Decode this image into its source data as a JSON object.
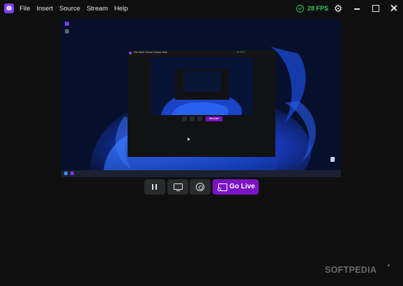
{
  "menu": [
    "File",
    "Insert",
    "Source",
    "Stream",
    "Help"
  ],
  "status": {
    "fps_label": "28 FPS",
    "fps_color": "#39c262"
  },
  "icons": {
    "app": "app-logo-icon",
    "fps": "check-circle-icon",
    "settings": "gear-icon",
    "minimize": "minimize-icon",
    "maximize": "maximize-icon",
    "close": "close-icon",
    "pause": "pause-icon",
    "display": "monitor-icon",
    "capture": "aperture-icon",
    "golive": "cast-icon"
  },
  "controls": {
    "golive_label": "Go Live"
  },
  "nested": {
    "menu": "File  Insert  Source  Stream  Help",
    "fps": "28 FPS",
    "golive": "Go Live"
  },
  "colors": {
    "accent": "#7a14c4",
    "background": "#0f0f10",
    "button": "#2a2b2e"
  },
  "watermark": "SOFTPEDIA"
}
